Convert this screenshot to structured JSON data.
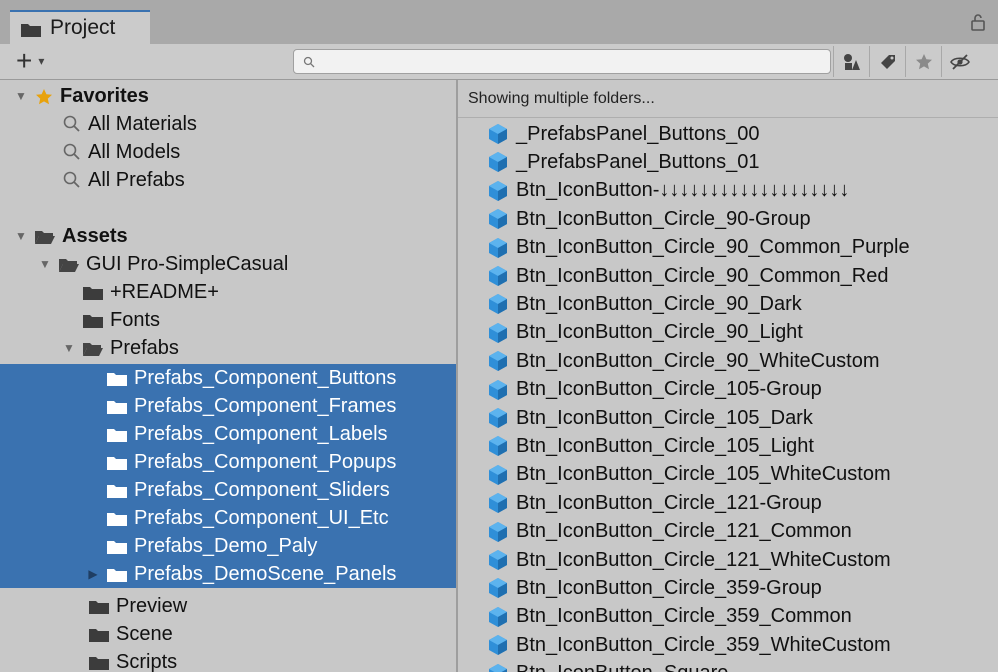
{
  "tab": {
    "title": "Project"
  },
  "toolbar": {
    "add_label": "+",
    "add_caret": "▾",
    "search": {
      "value": "",
      "placeholder": ""
    }
  },
  "icons": {
    "folder": "folder-icon",
    "open_folder": "open-folder-icon",
    "search": "search-icon",
    "prefab": "prefab-cube-icon",
    "star": "star-icon"
  },
  "colors": {
    "selection": "#3a72b0",
    "prefab_cube": "#2f8fd8"
  },
  "tree": {
    "favorites": {
      "label": "Favorites",
      "items": [
        "All Materials",
        "All Models",
        "All Prefabs"
      ]
    },
    "assets": {
      "label": "Assets"
    },
    "gui_pack": {
      "label": "GUI Pro-SimpleCasual"
    },
    "readme": {
      "label": "+README+"
    },
    "fonts": {
      "label": "Fonts"
    },
    "prefabs": {
      "label": "Prefabs"
    },
    "prefab_folders": [
      "Prefabs_Component_Buttons",
      "Prefabs_Component_Frames",
      "Prefabs_Component_Labels",
      "Prefabs_Component_Popups",
      "Prefabs_Component_Sliders",
      "Prefabs_Component_UI_Etc",
      "Prefabs_Demo_Paly",
      "Prefabs_DemoScene_Panels"
    ],
    "after": [
      "Preview",
      "Scene",
      "Scripts"
    ]
  },
  "content": {
    "status": "Showing multiple folders...",
    "items": [
      "_PrefabsPanel_Buttons_00",
      "_PrefabsPanel_Buttons_01",
      "Btn_IconButton-↓↓↓↓↓↓↓↓↓↓↓↓↓↓↓↓↓↓↓",
      "Btn_IconButton_Circle_90-Group",
      "Btn_IconButton_Circle_90_Common_Purple",
      "Btn_IconButton_Circle_90_Common_Red",
      "Btn_IconButton_Circle_90_Dark",
      "Btn_IconButton_Circle_90_Light",
      "Btn_IconButton_Circle_90_WhiteCustom",
      "Btn_IconButton_Circle_105-Group",
      "Btn_IconButton_Circle_105_Dark",
      "Btn_IconButton_Circle_105_Light",
      "Btn_IconButton_Circle_105_WhiteCustom",
      "Btn_IconButton_Circle_121-Group",
      "Btn_IconButton_Circle_121_Common",
      "Btn_IconButton_Circle_121_WhiteCustom",
      "Btn_IconButton_Circle_359-Group",
      "Btn_IconButton_Circle_359_Common",
      "Btn_IconButton_Circle_359_WhiteCustom",
      "Btn_IconButton_Square"
    ]
  }
}
